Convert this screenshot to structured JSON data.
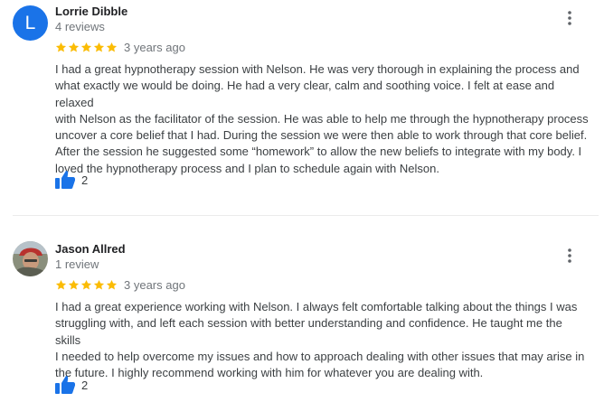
{
  "colors": {
    "avatar_bg": "#1a73e8",
    "star": "#fbbc04",
    "like_icon": "#1a73e8",
    "text": "#3c4043",
    "muted": "#70757a"
  },
  "reviews": [
    {
      "avatar_letter": "L",
      "reviewer_name": "Lorrie Dibble",
      "review_count": "4 reviews",
      "rating": 5,
      "time": "3 years ago",
      "text_lines": [
        "I had a great hypnotherapy session with Nelson. He was very thorough in explaining the process and",
        "what exactly we would be doing. He had a very clear, calm and soothing voice. I felt at ease and relaxed",
        "with Nelson as the facilitator of the session. He was able to help me through the hypnotherapy process",
        "uncover a core belief that I had. During the session we were then able to work through that core belief.",
        "After the session he suggested some “homework” to allow the new beliefs to integrate with my body. I",
        "loved the hypnotherapy process and  I plan to schedule again with Nelson."
      ],
      "likes": "2",
      "icons": {
        "more": "more-vert-icon",
        "like": "thumbs-up-icon"
      }
    },
    {
      "avatar_letter": "",
      "reviewer_name": "Jason Allred",
      "review_count": "1 review",
      "rating": 5,
      "time": "3 years ago",
      "text_lines": [
        "I had a great experience working with Nelson. I always felt comfortable talking about the things I was",
        "struggling with, and left each session with better understanding and confidence. He taught me the skills",
        "I needed to help overcome my issues and how to approach dealing with other issues that may arise in",
        "the future. I highly recommend working with him for whatever you are dealing with."
      ],
      "likes": "2",
      "icons": {
        "more": "more-vert-icon",
        "like": "thumbs-up-icon"
      }
    }
  ]
}
